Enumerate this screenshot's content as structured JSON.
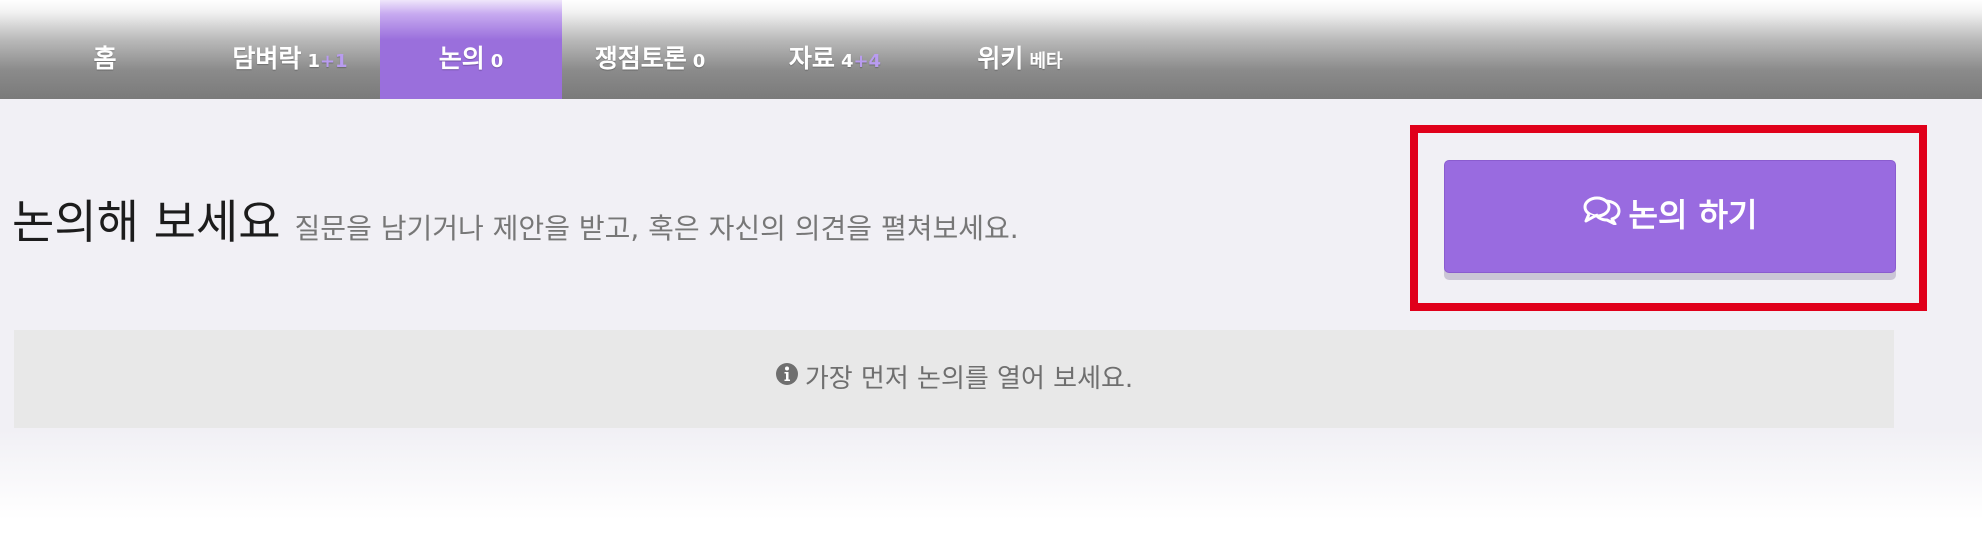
{
  "tabs": [
    {
      "label": "홈",
      "count": "",
      "count_extra": "",
      "sub": "",
      "active": false
    },
    {
      "label": "담벼락",
      "count": "1",
      "count_extra": "+1",
      "sub": "",
      "active": false
    },
    {
      "label": "논의",
      "count": "0",
      "count_extra": "",
      "sub": "",
      "active": true
    },
    {
      "label": "쟁점토론",
      "count": "0",
      "count_extra": "",
      "sub": "",
      "active": false
    },
    {
      "label": "자료",
      "count": "4",
      "count_extra": "+4",
      "sub": "",
      "active": false
    },
    {
      "label": "위키",
      "count": "",
      "count_extra": "",
      "sub": "베타",
      "active": false
    }
  ],
  "heading": {
    "title": "논의해 보세요",
    "subtitle": "질문을 남기거나 제안을 받고, 혹은 자신의 의견을 펼쳐보세요."
  },
  "discuss_button": {
    "label": "논의 하기",
    "icon": "comments-icon"
  },
  "notice": {
    "icon": "info-circle-icon",
    "text": "가장 먼저 논의를 열어 보세요."
  },
  "colors": {
    "accent": "#996be0",
    "highlight_frame": "#e0001a",
    "notice_bg": "#e8e8e8",
    "page_bg": "#f1f0f5"
  }
}
